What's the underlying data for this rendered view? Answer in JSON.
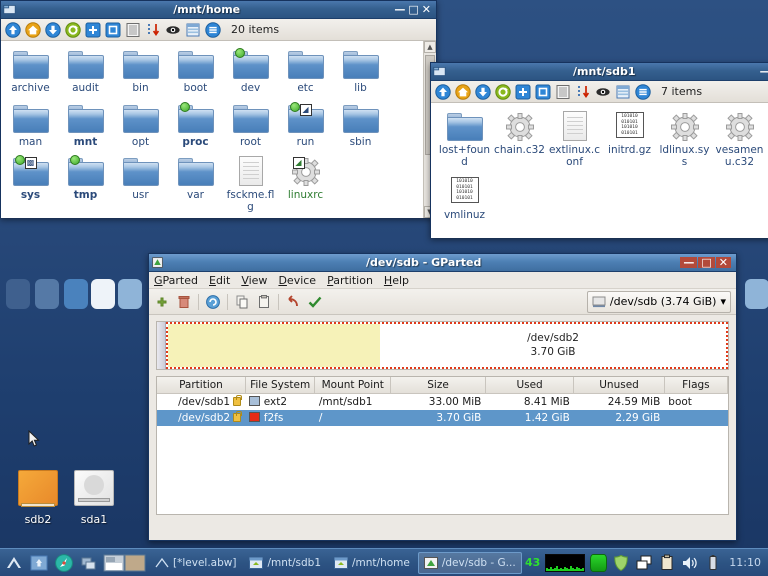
{
  "desktop": {
    "icons": [
      {
        "label": "sdb2",
        "icon": "drive-removable-icon",
        "type": "orange"
      },
      {
        "label": "sda1",
        "icon": "drive-harddisk-icon",
        "type": "white"
      }
    ],
    "cursor": "mouse-pointer"
  },
  "file_manager_home": {
    "title": "/mnt/home",
    "window_buttons": {
      "minimize": "—",
      "maximize": "□",
      "close": "✕"
    },
    "toolbar_icons": [
      "go-up-icon",
      "go-home-icon",
      "go-down-icon",
      "refresh-icon",
      "new-tab-icon",
      "select-all-icon",
      "list-view-icon",
      "sort-descending-icon",
      "show-hidden-icon",
      "detail-view-icon",
      "menu-icon"
    ],
    "item_count": "20 items",
    "items": [
      {
        "name": "archive",
        "type": "folder",
        "bold": false,
        "badge": "none"
      },
      {
        "name": "audit",
        "type": "folder",
        "bold": false,
        "badge": "none"
      },
      {
        "name": "bin",
        "type": "folder",
        "bold": false,
        "badge": "none"
      },
      {
        "name": "boot",
        "type": "folder",
        "bold": false,
        "badge": "none"
      },
      {
        "name": "dev",
        "type": "folder",
        "bold": false,
        "badge": "dot"
      },
      {
        "name": "etc",
        "type": "folder",
        "bold": false,
        "badge": "none"
      },
      {
        "name": "lib",
        "type": "folder",
        "bold": false,
        "badge": "none"
      },
      {
        "name": "man",
        "type": "folder",
        "bold": false,
        "badge": "none"
      },
      {
        "name": "mnt",
        "type": "folder",
        "bold": true,
        "badge": "none"
      },
      {
        "name": "opt",
        "type": "folder",
        "bold": false,
        "badge": "none"
      },
      {
        "name": "proc",
        "type": "folder",
        "bold": true,
        "badge": "dot"
      },
      {
        "name": "root",
        "type": "folder",
        "bold": false,
        "badge": "none"
      },
      {
        "name": "run",
        "type": "folder",
        "bold": false,
        "badge": "dot-link"
      },
      {
        "name": "sbin",
        "type": "folder",
        "bold": false,
        "badge": "none"
      },
      {
        "name": "sys",
        "type": "folder",
        "bold": true,
        "badge": "dot-emb"
      },
      {
        "name": "tmp",
        "type": "folder",
        "bold": true,
        "badge": "dot"
      },
      {
        "name": "usr",
        "type": "folder",
        "bold": false,
        "badge": "none"
      },
      {
        "name": "var",
        "type": "folder",
        "bold": false,
        "badge": "none"
      },
      {
        "name": "fsckme.flg",
        "type": "document",
        "bold": false,
        "badge": "none"
      },
      {
        "name": "linuxrc",
        "type": "gear",
        "bold": false,
        "badge": "link",
        "color": "green"
      }
    ]
  },
  "file_manager_sdb1": {
    "title": "/mnt/sdb1",
    "window_buttons": {
      "minimize": "—",
      "maximize": "□"
    },
    "toolbar_icons": [
      "go-up-icon",
      "go-home-icon",
      "go-down-icon",
      "refresh-icon",
      "new-tab-icon",
      "select-all-icon",
      "list-view-icon",
      "sort-descending-icon",
      "show-hidden-icon",
      "detail-view-icon",
      "menu-icon"
    ],
    "item_count": "7 items",
    "items": [
      {
        "name": "lost+found",
        "type": "folder",
        "color": "blue"
      },
      {
        "name": "chain.c32",
        "type": "gear",
        "color": "dark"
      },
      {
        "name": "extlinux.conf",
        "type": "document",
        "color": "dark"
      },
      {
        "name": "initrd.gz",
        "type": "binary",
        "color": "dark"
      },
      {
        "name": "ldlinux.sys",
        "type": "gear",
        "color": "dark"
      },
      {
        "name": "vesamenu.c32",
        "type": "gear",
        "color": "dark"
      },
      {
        "name": "vmlinuz",
        "type": "binary",
        "color": "dark"
      }
    ]
  },
  "gparted": {
    "title": "/dev/sdb - GParted",
    "window_buttons": {
      "minimize": "—",
      "maximize": "□",
      "close": "✕"
    },
    "menus": [
      "GParted",
      "Edit",
      "View",
      "Device",
      "Partition",
      "Help"
    ],
    "toolbar_icons": [
      "new-partition-icon",
      "delete-partition-icon",
      "undo-all-icon",
      "copy-icon",
      "paste-icon",
      "undo-icon",
      "apply-icon"
    ],
    "device_selector": {
      "icon": "harddisk-icon",
      "label": "/dev/sdb  (3.74 GiB)",
      "caret": "▾"
    },
    "graph": {
      "selected_partition": "/dev/sdb2",
      "selected_size": "3.70 GiB",
      "used_fraction_percent": 38
    },
    "table": {
      "columns": [
        "Partition",
        "File System",
        "Mount Point",
        "Size",
        "Used",
        "Unused",
        "Flags"
      ],
      "rows": [
        {
          "partition": "/dev/sdb1",
          "locked": true,
          "swatch": "#a8bfd8",
          "filesystem": "ext2",
          "mount_point": "/mnt/sdb1",
          "size": "33.00 MiB",
          "used": "8.41 MiB",
          "unused": "24.59 MiB",
          "flags": "boot",
          "selected": false
        },
        {
          "partition": "/dev/sdb2",
          "locked": true,
          "swatch": "#e62a16",
          "filesystem": "f2fs",
          "mount_point": "/",
          "size": "3.70 GiB",
          "used": "1.42 GiB",
          "unused": "2.29 GiB",
          "flags": "",
          "selected": true
        }
      ]
    }
  },
  "taskbar": {
    "launchers": [
      "menu-arrow-icon",
      "file-manager-icon",
      "web-browser-icon",
      "show-desktop-icon",
      "pager-icon"
    ],
    "tasks": [
      {
        "label": "[*level.abw]",
        "icon": "abiword-icon",
        "active": false
      },
      {
        "label": "/mnt/sdb1",
        "icon": "file-manager-window-icon",
        "active": false
      },
      {
        "label": "/mnt/home",
        "icon": "file-manager-window-icon",
        "active": false
      },
      {
        "label": "/dev/sdb - G...",
        "icon": "gparted-icon",
        "active": true
      }
    ],
    "tray": {
      "cpu_label": "43",
      "icons": [
        "cpu-graph-icon",
        "memory-icon",
        "shield-icon",
        "window-switch-icon",
        "clipboard-icon",
        "volume-icon",
        "battery-icon"
      ],
      "clock": "11:10"
    }
  }
}
